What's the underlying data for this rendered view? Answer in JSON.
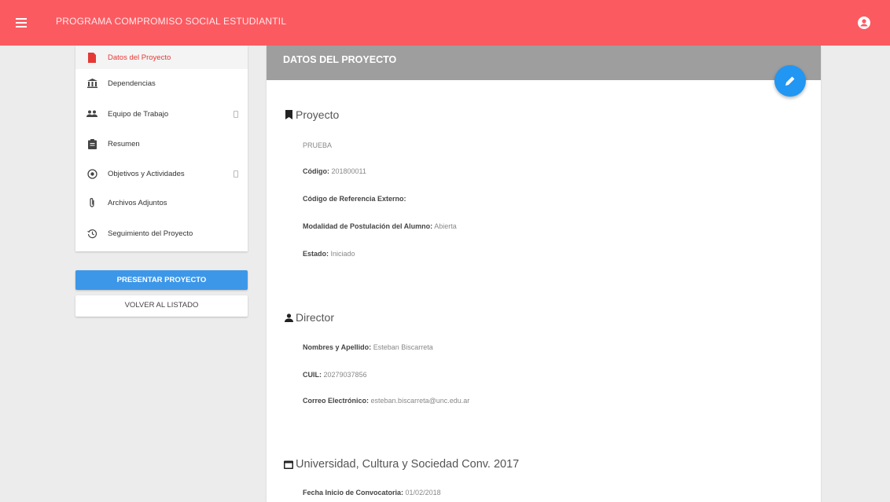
{
  "app": {
    "title": "PROGRAMA COMPROMISO SOCIAL ESTUDIANTIL",
    "colors": {
      "topbar": "#fc5a61",
      "primary_button": "#3d97e8",
      "fab": "#2196f3",
      "header": "#9e9e9e",
      "active_nav": "#e53935"
    }
  },
  "icons": {
    "menu": "hamburger-icon",
    "account": "account-circle-icon",
    "edit": "pencil-icon"
  },
  "sidebar": {
    "items": [
      {
        "label": "Datos del Proyecto",
        "icon": "document-icon",
        "active": true
      },
      {
        "label": "Dependencias",
        "icon": "institution-icon"
      },
      {
        "label": "Equipo de Trabajo",
        "icon": "people-icon",
        "expandable": true
      },
      {
        "label": "Resumen",
        "icon": "clipboard-icon"
      },
      {
        "label": "Objetivos y Actividades",
        "icon": "target-icon",
        "expandable": true
      },
      {
        "label": "Archivos Adjuntos",
        "icon": "paperclip-icon"
      },
      {
        "label": "Seguimiento del Proyecto",
        "icon": "history-icon"
      }
    ]
  },
  "actions": {
    "presentar": "PRESENTAR PROYECTO",
    "volver": "VOLVER AL LISTADO"
  },
  "card": {
    "title": "DATOS DEL PROYECTO",
    "sections": {
      "proyecto": {
        "title": "Proyecto",
        "name": "PRUEBA",
        "codigo_label": "Código:",
        "codigo_value": "201800011",
        "ref_label": "Código de Referencia Externo:",
        "ref_value": "",
        "modalidad_label": "Modalidad de Postulación del Alumno:",
        "modalidad_value": "Abierta",
        "estado_label": "Estado:",
        "estado_value": "Iniciado"
      },
      "director": {
        "title": "Director",
        "nombre_label": "Nombres y Apellido:",
        "nombre_value": "Esteban Biscarreta",
        "cuil_label": "CUIL:",
        "cuil_value": "20279037856",
        "correo_label": "Correo Electrónico:",
        "correo_value": "esteban.biscarreta@unc.edu.ar"
      },
      "convocatoria": {
        "title": "Universidad, Cultura y Sociedad Conv. 2017",
        "fecha_label": "Fecha Inicio de Convocatoria:",
        "fecha_value": "01/02/2018"
      }
    }
  }
}
